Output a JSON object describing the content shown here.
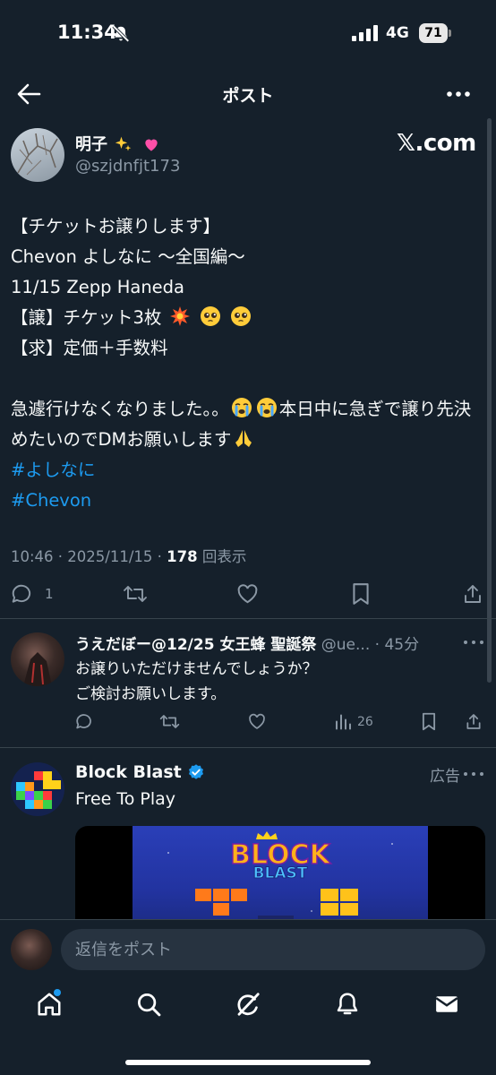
{
  "status_bar": {
    "time": "11:34",
    "network": "4G",
    "battery": "71"
  },
  "nav": {
    "title": "ポスト"
  },
  "post": {
    "author_name": "明子",
    "author_handle": "@szjdnfjt173",
    "brand": "𝕏.com",
    "lines": {
      "l1": "【チケットお譲りします】",
      "l2": "Chevon よしなに 〜全国編〜",
      "l3": "11/15  Zepp Haneda",
      "l4": "【譲】チケット3枚",
      "l5": "【求】定価＋手数料",
      "l6a": "急遽行けなくなりました。。",
      "l6b": "本日中に急ぎで譲り先決めたいのでDMお願いします",
      "tag1": " #よしなに",
      "tag2": "#Chevon"
    },
    "meta": {
      "time_date": "10:46 · 2025/11/15 · ",
      "views": "178",
      "views_label": " 回表示"
    },
    "reply_count": "1"
  },
  "reply": {
    "name": "うえだぼー@12/25 女王蜂 聖誕祭",
    "handle": " @ue...",
    "age": " · 45分",
    "text_line1": "お譲りいただけませんでしょうか？",
    "text_line2": "ご検討お願いします。",
    "views": "26"
  },
  "ad": {
    "name": "Block Blast",
    "label": "広告",
    "subtitle": "Free To Play",
    "art_title": "BLOCK",
    "art_subtitle": "BLAST"
  },
  "composer": {
    "placeholder": "返信をポスト"
  },
  "colors": {
    "background": "#15202b",
    "accent": "#1d9bf0",
    "muted": "#8b98a5",
    "divider": "#38444d"
  },
  "icons": [
    "back-arrow-icon",
    "more-icon",
    "reply-icon",
    "repost-icon",
    "like-icon",
    "bookmark-icon",
    "share-icon",
    "views-icon",
    "verified-icon",
    "home-icon",
    "search-icon",
    "grok-icon",
    "notifications-icon",
    "messages-icon"
  ]
}
